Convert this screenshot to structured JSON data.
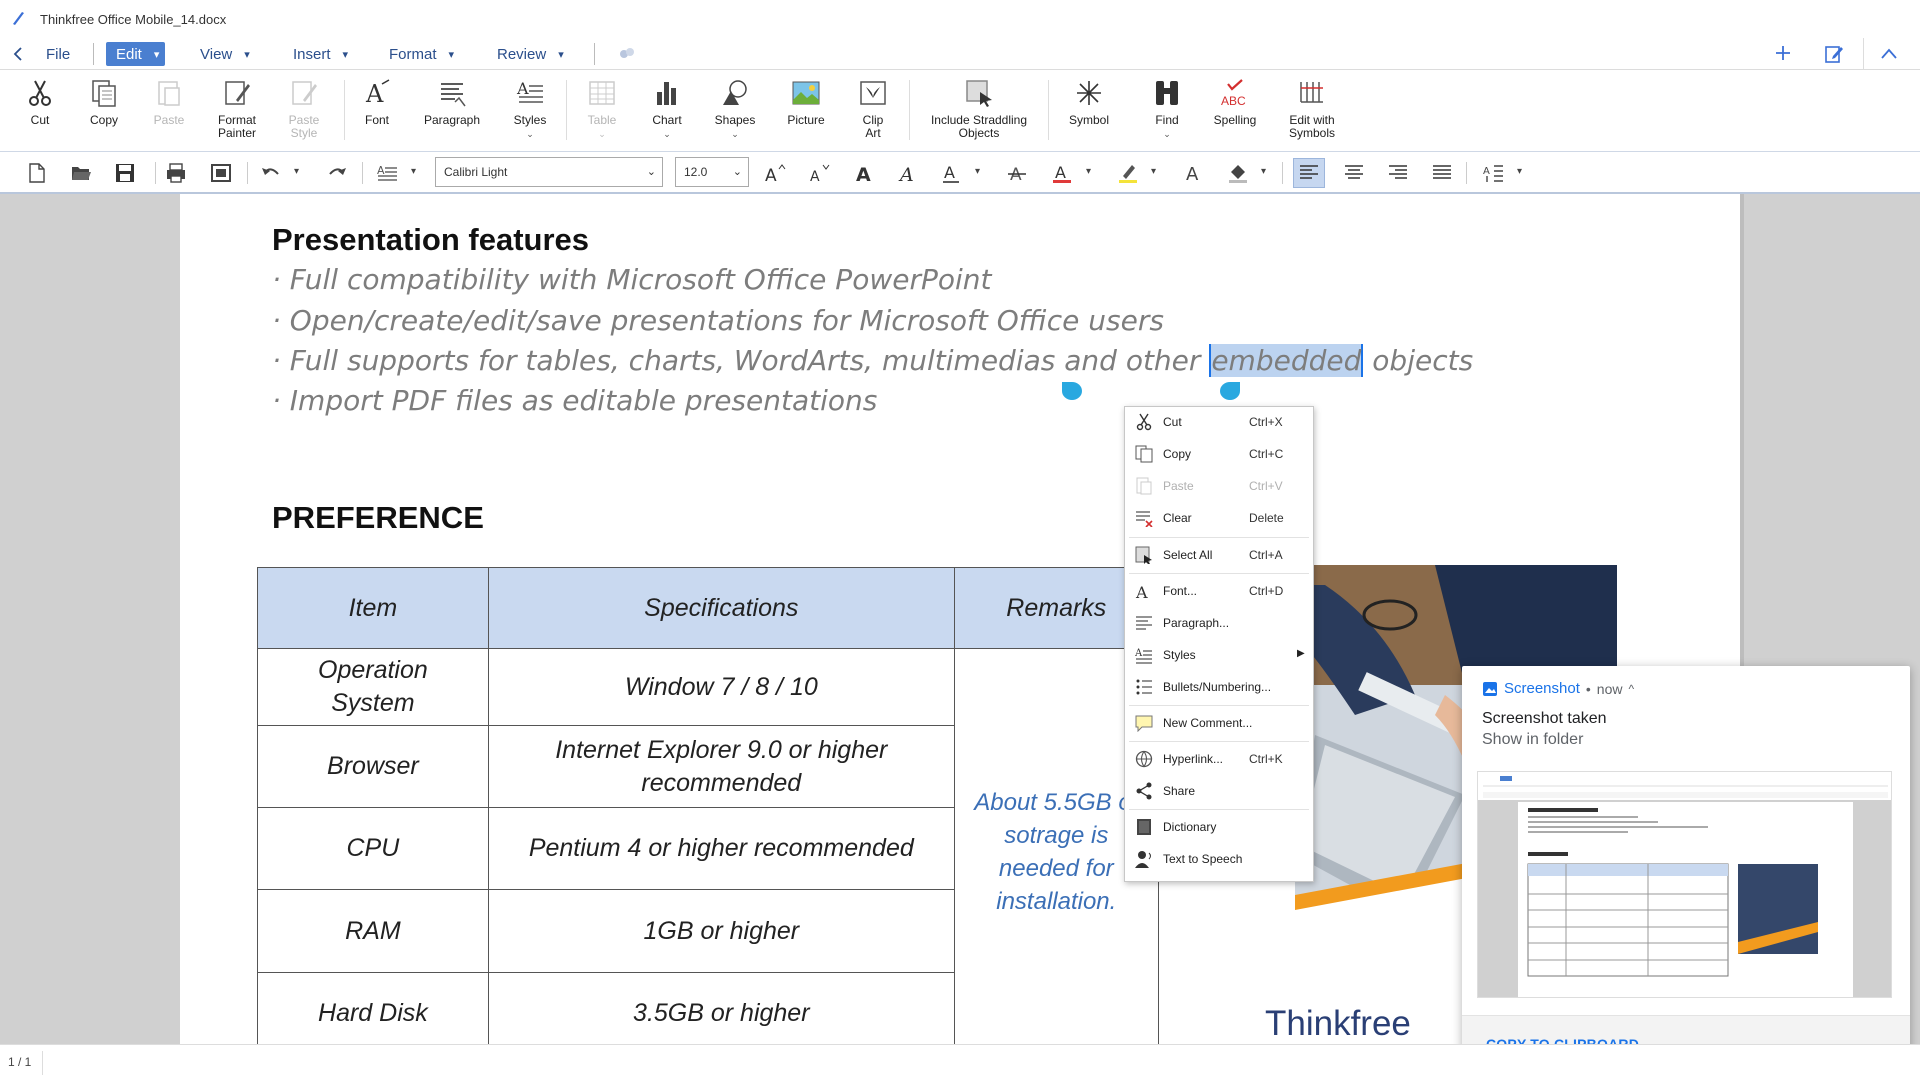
{
  "window": {
    "title": "Thinkfree Office Mobile_14.docx"
  },
  "menu": {
    "file": "File",
    "edit": "Edit",
    "view": "View",
    "insert": "Insert",
    "format": "Format",
    "review": "Review"
  },
  "ribbon": {
    "cut": "Cut",
    "copy": "Copy",
    "paste": "Paste",
    "format_painter": "Format Painter",
    "paste_style": "Paste Style",
    "font": "Font",
    "paragraph": "Paragraph",
    "styles": "Styles",
    "table": "Table",
    "chart": "Chart",
    "shapes": "Shapes",
    "picture": "Picture",
    "clip_art": "Clip Art",
    "include_straddling": "Include Straddling Objects",
    "symbol": "Symbol",
    "find": "Find",
    "spelling": "Spelling",
    "edit_with_symbols": "Edit with Symbols",
    "spelling_icon_text": "ABC"
  },
  "toolbar": {
    "font_name": "Calibri Light",
    "font_size": "12.0"
  },
  "document": {
    "heading1": "Presentation features",
    "bullets": [
      "· Full compatibility with Microsoft Office PowerPoint",
      "· Open/create/edit/save presentations for Microsoft Office users"
    ],
    "bullet3_before": "· Full supports for tables, charts, WordArts, multimedias and other ",
    "bullet3_selected": "embedded",
    "bullet3_after": " objects",
    "bullet4": "· Import PDF files as editable presentations",
    "heading2": "PREFERENCE",
    "table": {
      "headers": [
        "Item",
        "Specifications",
        "Remarks"
      ],
      "rows": [
        [
          "Operation System",
          "Window 7 / 8 / 10"
        ],
        [
          "Browser",
          "Internet Explorer 9.0 or higher recommended"
        ],
        [
          "CPU",
          "Pentium 4 or higher recommended"
        ],
        [
          "RAM",
          "1GB or higher"
        ],
        [
          "Hard Disk",
          "3.5GB or higher"
        ]
      ],
      "remarks": "About 5.5GB of sotrage is needed for installation."
    },
    "logo_text": "Thinkfree"
  },
  "context_menu": {
    "items": [
      {
        "label": "Cut",
        "shortcut": "Ctrl+X"
      },
      {
        "label": "Copy",
        "shortcut": "Ctrl+C"
      },
      {
        "label": "Paste",
        "shortcut": "Ctrl+V"
      },
      {
        "label": "Clear",
        "shortcut": "Delete"
      },
      {
        "label": "Select All",
        "shortcut": "Ctrl+A"
      },
      {
        "label": "Font...",
        "shortcut": "Ctrl+D"
      },
      {
        "label": "Paragraph...",
        "shortcut": ""
      },
      {
        "label": "Styles",
        "shortcut": ""
      },
      {
        "label": "Bullets/Numbering...",
        "shortcut": ""
      },
      {
        "label": "New Comment...",
        "shortcut": ""
      },
      {
        "label": "Hyperlink...",
        "shortcut": "Ctrl+K"
      },
      {
        "label": "Share",
        "shortcut": ""
      },
      {
        "label": "Dictionary",
        "shortcut": ""
      },
      {
        "label": "Text to Speech",
        "shortcut": ""
      }
    ]
  },
  "notification": {
    "app": "Screenshot",
    "time": "now",
    "title": "Screenshot taken",
    "subtitle": "Show in folder",
    "action": "COPY TO CLIPBOARD"
  },
  "status": {
    "page": "1 / 1"
  },
  "colors": {
    "accent": "#4a7fd0",
    "menu_text": "#2b4f8c",
    "selection": "#bcd3f0",
    "remarks": "#3b6fb6",
    "android_blue": "#1a73e8"
  }
}
